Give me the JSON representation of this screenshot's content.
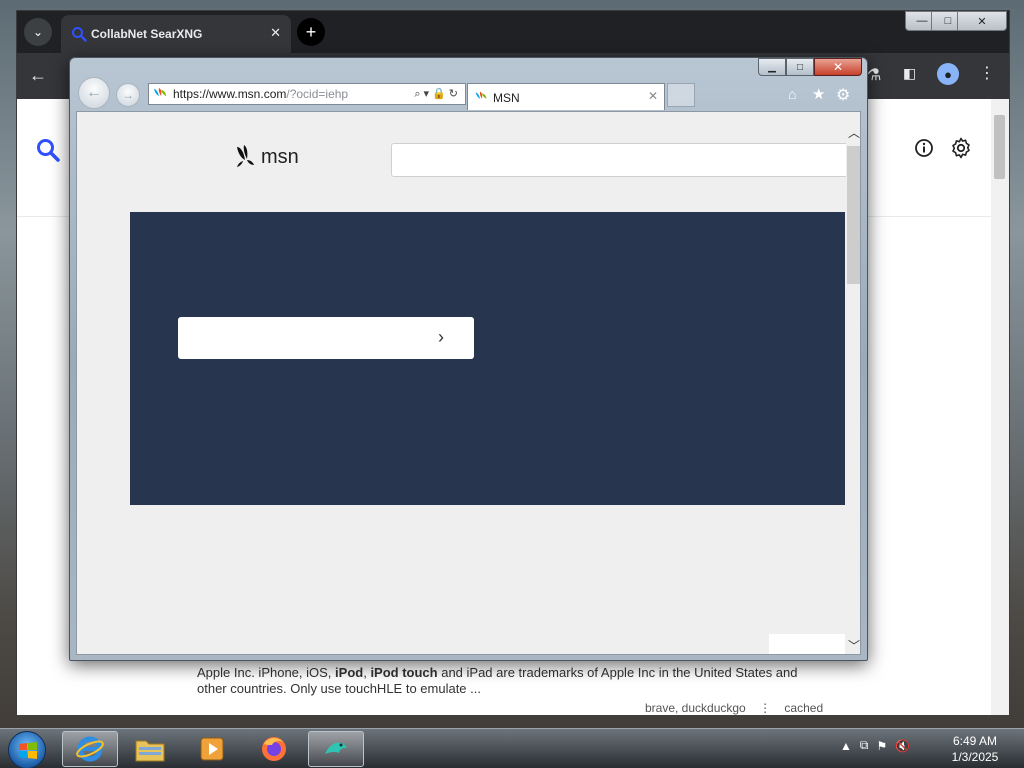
{
  "chrome": {
    "tab_title": "CollabNet SearXNG",
    "tab_close": "✕",
    "new_tab": "+",
    "min": "—",
    "max": "□",
    "close": "✕"
  },
  "searx": {
    "snippet_line1_pre": "Apple Inc. iPhone, iOS, ",
    "snippet_bold1": "iPod",
    "snippet_mid": ", ",
    "snippet_bold2": "iPod touch",
    "snippet_line1_post": " and iPad are trademarks of Apple Inc in the United States and",
    "snippet_line2": "other countries. Only use touchHLE to emulate ...",
    "engines": "brave, duckduckgo",
    "more": "⋮",
    "cached": "cached"
  },
  "ie": {
    "url_host": "https://www.msn.com",
    "url_rest": "/?ocid=iehp",
    "addr_icons": "⌕▾🔒↻",
    "tab_title": "MSN",
    "tab_close": "✕",
    "min": "▁",
    "max": "□",
    "close": "✕"
  },
  "msn": {
    "logo_text": "msn",
    "hero_chevron": "›"
  },
  "taskbar": {
    "time": "6:49 AM",
    "date": "1/3/2025"
  },
  "colors": {
    "hero_bg": "#28354f",
    "ie_close": "#c6402a",
    "chrome_bg": "#202124",
    "searx_accent": "#3050ff"
  },
  "icons": {
    "tab_search": "chevron-down-icon",
    "chrome_back": "arrow-left-icon",
    "chrome_labs": "flask-icon",
    "chrome_side": "side-panel-icon",
    "chrome_profile": "profile-icon",
    "chrome_menu": "kebab-menu-icon",
    "searx_search": "search-icon",
    "searx_info": "info-icon",
    "searx_settings": "gear-icon",
    "ie_home": "home-icon",
    "ie_favorites": "star-icon",
    "ie_tools": "gear-icon"
  }
}
